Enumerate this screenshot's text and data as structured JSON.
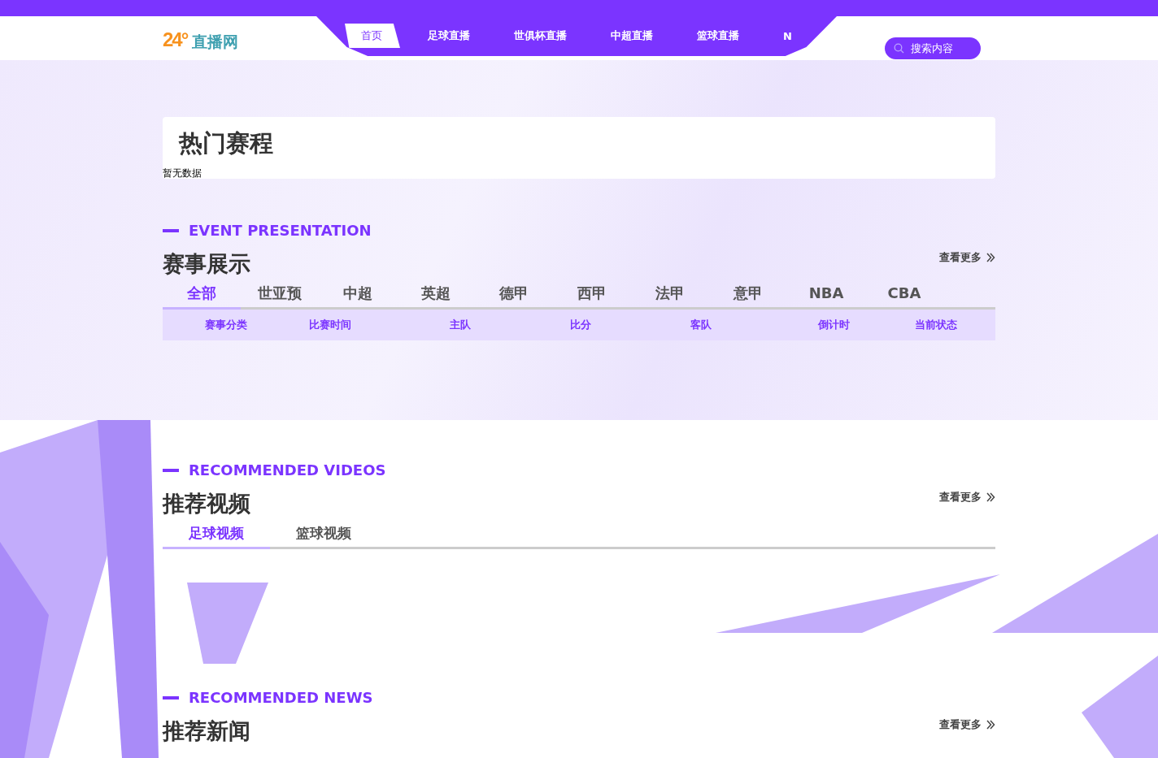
{
  "header": {
    "logo": {
      "mark": "24°",
      "name": "直播网"
    },
    "nav": [
      {
        "label": "首页",
        "selected": true
      },
      {
        "label": "足球直播",
        "selected": false
      },
      {
        "label": "世俱杯直播",
        "selected": false
      },
      {
        "label": "中超直播",
        "selected": false
      },
      {
        "label": "篮球直播",
        "selected": false
      },
      {
        "label": "N",
        "selected": false
      }
    ],
    "search": {
      "placeholder": "搜索内容"
    }
  },
  "hot_schedule": {
    "title": "热门赛程",
    "empty_text": "暂无数据"
  },
  "events": {
    "subtitle": "EVENT PRESENTATION",
    "title": "赛事展示",
    "more": "查看更多",
    "tabs": [
      {
        "label": "全部",
        "selected": true
      },
      {
        "label": "世亚预",
        "selected": false
      },
      {
        "label": "中超",
        "selected": false
      },
      {
        "label": "英超",
        "selected": false
      },
      {
        "label": "德甲",
        "selected": false
      },
      {
        "label": "西甲",
        "selected": false
      },
      {
        "label": "法甲",
        "selected": false
      },
      {
        "label": "意甲",
        "selected": false
      },
      {
        "label": "NBA",
        "selected": false
      },
      {
        "label": "CBA",
        "selected": false
      }
    ],
    "table": {
      "columns": [
        "赛事分类",
        "比赛时间",
        "主队",
        "比分",
        "客队",
        "倒计时",
        "当前状态"
      ]
    }
  },
  "videos": {
    "subtitle": "RECOMMENDED VIDEOS",
    "title": "推荐视频",
    "more": "查看更多",
    "tabs": [
      {
        "label": "足球视频",
        "selected": true
      },
      {
        "label": "篮球视频",
        "selected": false
      }
    ]
  },
  "news": {
    "subtitle": "RECOMMENDED NEWS",
    "title": "推荐新闻",
    "more": "查看更多"
  }
}
